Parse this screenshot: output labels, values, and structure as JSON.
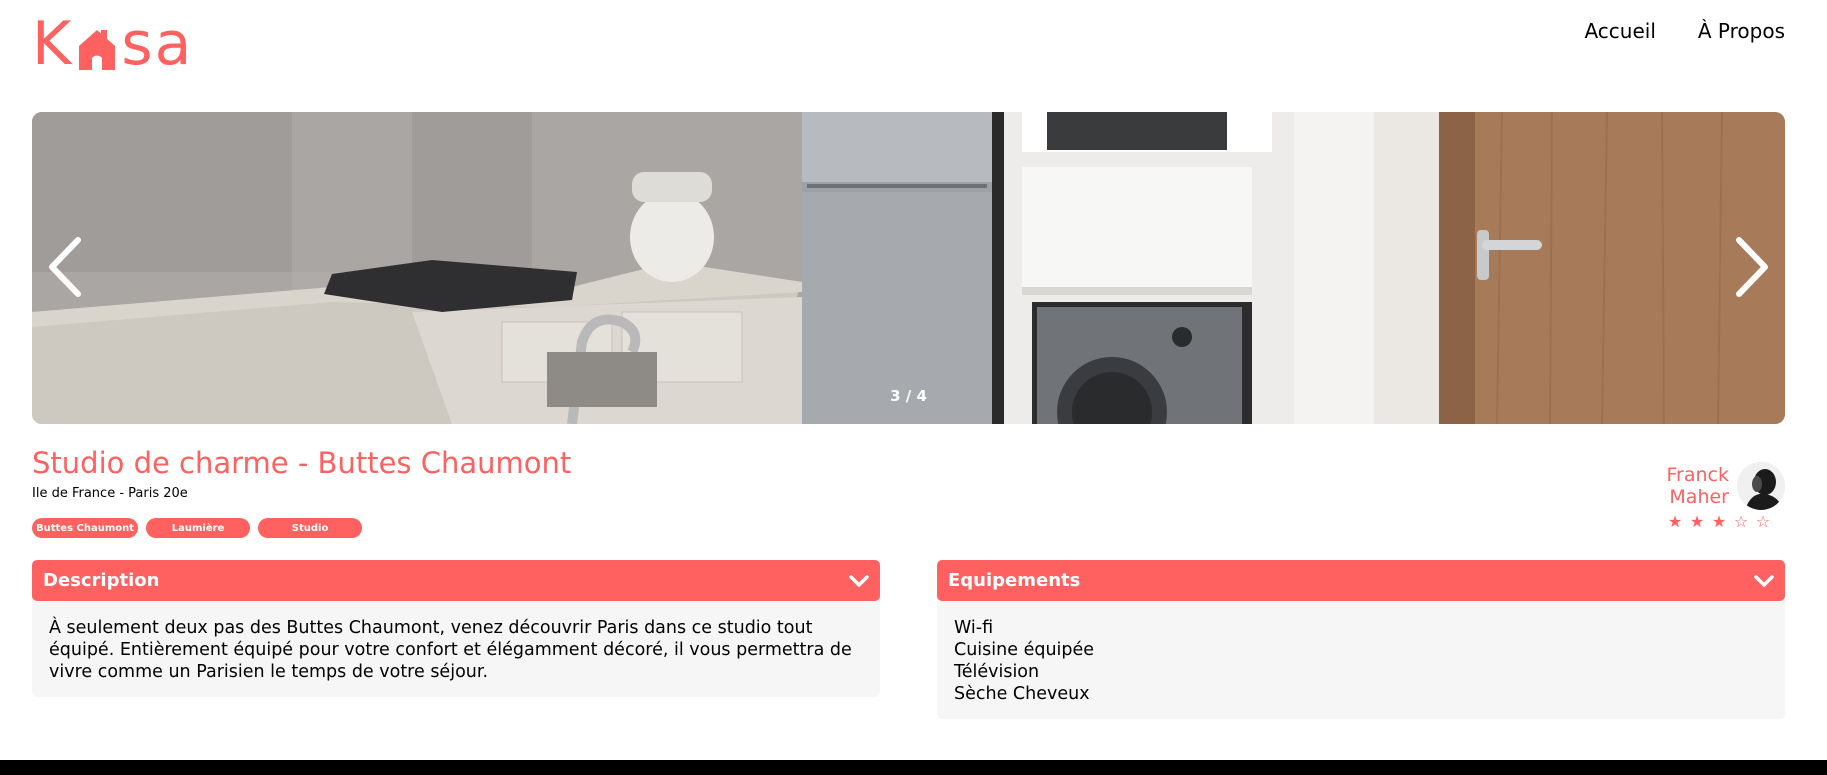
{
  "brand": {
    "logo_letters_left": "K",
    "logo_letters_right": "sa",
    "accent": "#FF6060"
  },
  "nav": {
    "home_label": "Accueil",
    "about_label": "À Propos"
  },
  "carousel": {
    "counter": "3 / 4",
    "prev_icon": "chevron-left-icon",
    "next_icon": "chevron-right-icon"
  },
  "listing": {
    "title": "Studio de charme - Buttes Chaumont",
    "location": "Ile de France - Paris 20e",
    "tags": [
      "Buttes Chaumont",
      "Laumière",
      "Studio"
    ],
    "host": {
      "first_name": "Franck",
      "last_name": "Maher"
    },
    "rating": {
      "value": 3,
      "max": 5,
      "filled_star": "★",
      "empty_star": "☆"
    }
  },
  "description": {
    "title": "Description",
    "text": "À seulement deux pas des Buttes Chaumont, venez découvrir Paris dans ce studio tout équipé. Entièrement équipé pour votre confort et élégamment décoré, il vous permettra de vivre comme un Parisien le temps de votre séjour."
  },
  "equipments": {
    "title": "Equipements",
    "items": [
      "Wi-fi",
      "Cuisine équipée",
      "Télévision",
      "Sèche Cheveux"
    ]
  }
}
